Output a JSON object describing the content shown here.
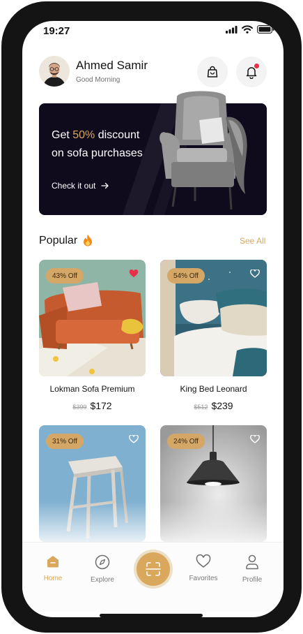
{
  "status": {
    "time": "19:27"
  },
  "header": {
    "name": "Ahmed Samir",
    "greeting": "Good Morning"
  },
  "banner": {
    "line1_prefix": "Get ",
    "line1_highlight": "50%",
    "line1_suffix": " discount",
    "line2": "on sofa purchases",
    "cta": "Check it out"
  },
  "popular": {
    "title": "Popular",
    "see_all": "See All",
    "products": [
      {
        "discount": "43% Off",
        "name": "Lokman Sofa Premium",
        "old_price": "$399",
        "price": "$172",
        "favorite": true
      },
      {
        "discount": "54% Off",
        "name": "King Bed Leonard",
        "old_price": "$512",
        "price": "$239",
        "favorite": false
      },
      {
        "discount": "31% Off",
        "favorite": false
      },
      {
        "discount": "24% Off",
        "favorite": false
      }
    ]
  },
  "nav": {
    "items": [
      {
        "label": "Home",
        "icon": "home-icon",
        "active": true
      },
      {
        "label": "Explore",
        "icon": "compass-icon",
        "active": false
      },
      {
        "label": "Favorites",
        "icon": "heart-icon",
        "active": false
      },
      {
        "label": "Profile",
        "icon": "user-icon",
        "active": false
      }
    ]
  },
  "colors": {
    "accent": "#d9a85c",
    "banner_bg": "#0f0b1d",
    "favorite": "#e8304a"
  }
}
